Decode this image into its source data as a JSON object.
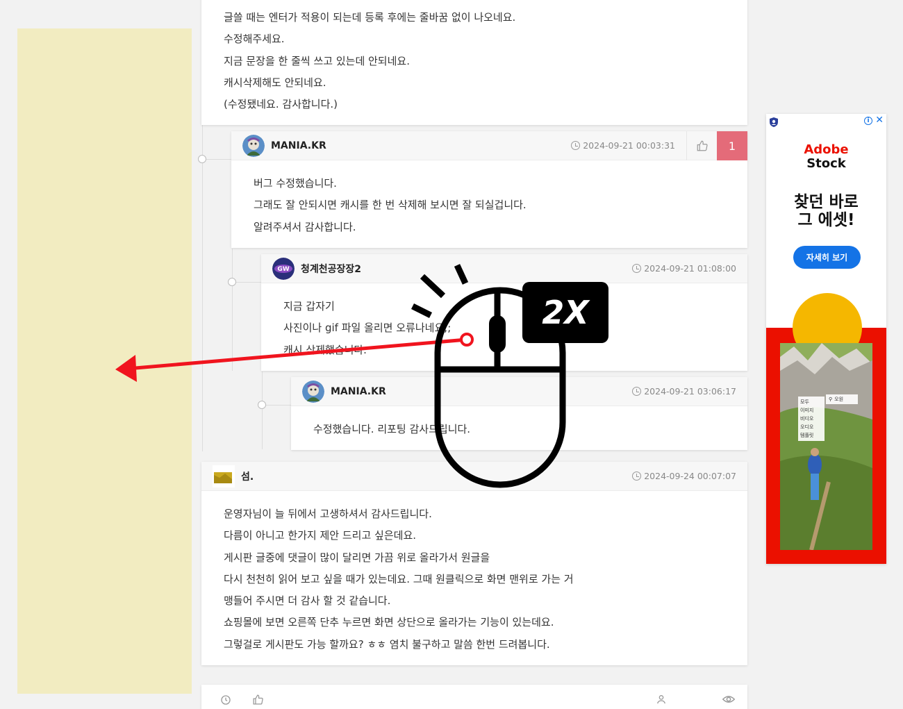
{
  "post": {
    "lines": [
      "글쓸 때는 엔터가 적용이 되는데 등록 후에는 줄바꿈 없이 나오네요.",
      "수정해주세요.",
      "지금 문장을 한 줄씩 쓰고 있는데 안되네요.",
      "캐시삭제해도 안되네요.",
      "(수정됐네요. 감사합니다.)"
    ]
  },
  "comments": [
    {
      "author": "MANIA.KR",
      "timestamp": "2024-09-21 00:03:31",
      "like_count": "1",
      "lines": [
        "버그 수정했습니다.",
        "그래도 잘 안되시면 캐시를 한 번 삭제해 보시면 잘 되실겁니다.",
        "알려주셔서 감사합니다."
      ]
    },
    {
      "author": "청계천공장장2",
      "timestamp": "2024-09-21 01:08:00",
      "lines": [
        "지금 갑자기",
        "사진이나 gif 파일 올리면 오류나네요;;",
        "캐시 삭제했습니다."
      ]
    },
    {
      "author": "MANIA.KR",
      "timestamp": "2024-09-21 03:06:17",
      "lines": [
        "수정했습니다. 리포팅 감사드립니다."
      ]
    },
    {
      "author": "섬.",
      "timestamp": "2024-09-24 00:07:07",
      "lines": [
        "운영자님이 늘 뒤에서 고생하셔서 감사드립니다.",
        "다름이 아니고 한가지 제안 드리고 싶은데요.",
        "게시판 글중에 댓글이 많이 달리면 가끔 위로 올라가서 원글을",
        "다시 천천히 읽어 보고 싶을 때가 있는데요. 그때 원클릭으로 화면 맨위로 가는 거",
        "맹들어 주시면 더 감사 할 것 같습니다.",
        "쇼핑몰에 보면 오른쪽 단추 누르면 화면 상단으로 올라가는 기능이 있는데요.",
        "그렇걸로 게시판도 가능 할까요? ㅎㅎ 염치 불구하고 말씀 한번 드려봅니다."
      ]
    }
  ],
  "overlay": {
    "badge": "2X"
  },
  "ad": {
    "brand_line1": "Adobe",
    "brand_line2": "Stock",
    "headline_line1": "찾던 바로",
    "headline_line2": "그 에셋!",
    "cta": "자세히 보기",
    "info": "i",
    "close": "✕",
    "menu_items": [
      "모두",
      "이미지",
      "비디오",
      "오디오",
      "템플릿"
    ],
    "search_label": "오원"
  },
  "colors": {
    "accent_like": "#e46b79",
    "left_panel": "#f2ecc1",
    "arrow": "#f0141e",
    "ad_red": "#eb1000",
    "ad_blue": "#1473e6"
  }
}
